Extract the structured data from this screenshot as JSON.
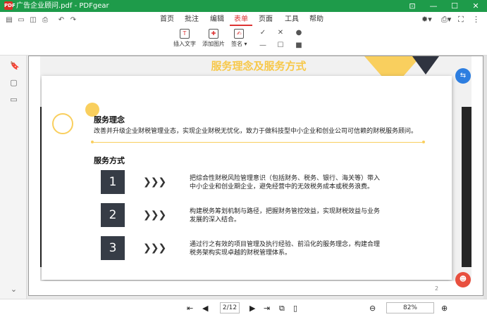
{
  "app": {
    "logo_text": "PDF",
    "title": "广告企业顾问.pdf - PDFgear",
    "window_controls": [
      "⊡",
      "—",
      "☐",
      "✕"
    ]
  },
  "quick_access": [
    "▤",
    "▭",
    "◫",
    "⎙",
    "↶",
    "↷"
  ],
  "menu": {
    "tabs": [
      "首页",
      "批注",
      "编辑",
      "表单",
      "页面",
      "工具",
      "帮助"
    ],
    "active": "表单"
  },
  "toolbar_right": [
    "✹▾",
    "⎙▾",
    "⛶",
    "⋮"
  ],
  "tools": [
    {
      "label": "插入文字",
      "icon": "T"
    },
    {
      "label": "添加图片",
      "icon": "✚"
    },
    {
      "label": "签名 ▾",
      "icon": "✍"
    }
  ],
  "form_symbols": [
    "✓",
    "✕",
    "●",
    "—",
    "☐",
    "■"
  ],
  "sidebar": [
    "🔖",
    "▢",
    "▭"
  ],
  "sidebar_expand": "⌄",
  "slide": {
    "title": "服务理念及服务方式",
    "concept": {
      "heading": "服务理念",
      "text": "改善并升级企业财税管理业态，实现企业财税无忧化，致力于做科技型中小企业和创业公司可信赖的财税服务顾问。"
    },
    "methods": {
      "heading": "服务方式",
      "items": [
        {
          "num": "1",
          "arrows": "❯❯❯",
          "text_line1": "把综合性财税风险管理意识（包括财务、税务、银行、海关等）带入",
          "text_line2": "中小企业和创业期企业，避免经营中的无效税务成本或税务浪费。"
        },
        {
          "num": "2",
          "arrows": "❯❯❯",
          "text_line1": "构建税务筹划机制与路径，把握财务管控效益，实现财税效益与业务",
          "text_line2": "发展的深入结合。"
        },
        {
          "num": "3",
          "arrows": "❯❯❯",
          "text_line1": "通过行之有效的项目管理及执行经验、前沿化的服务理念，构建合理",
          "text_line2": "税务架构实现卓越的财税管理体系。"
        }
      ]
    },
    "page_number": "2"
  },
  "fab": {
    "translate": "⇆",
    "assistant": "☻"
  },
  "status": {
    "nav": [
      "⇤",
      "◀",
      "▶",
      "⇥"
    ],
    "page_current": "2",
    "page_total": "/12",
    "page_display": "2/12",
    "extra_icons": [
      "⧉",
      "▯"
    ],
    "zoom_minus": "⊖",
    "zoom": "82%",
    "zoom_plus": "⊕"
  }
}
